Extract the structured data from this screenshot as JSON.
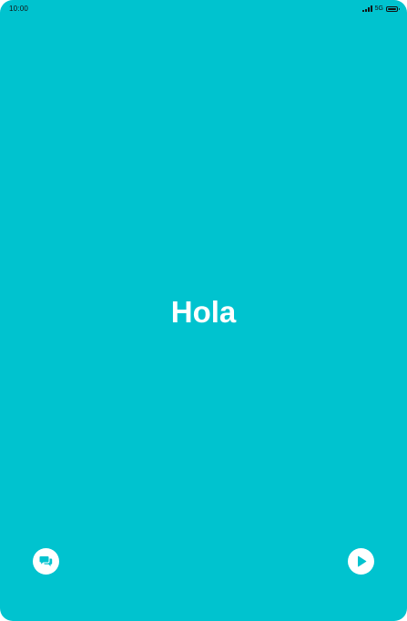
{
  "status_bar": {
    "time": "10:00",
    "network": "5G",
    "icons": [
      "signal-icon",
      "battery-icon"
    ]
  },
  "main": {
    "greeting": "Hola"
  },
  "controls": {
    "left_icon": "chat-bubbles-icon",
    "right_icon": "play-icon"
  },
  "colors": {
    "background": "#00C3CF",
    "foreground": "#FFFFFF",
    "status_text": "#111111"
  }
}
